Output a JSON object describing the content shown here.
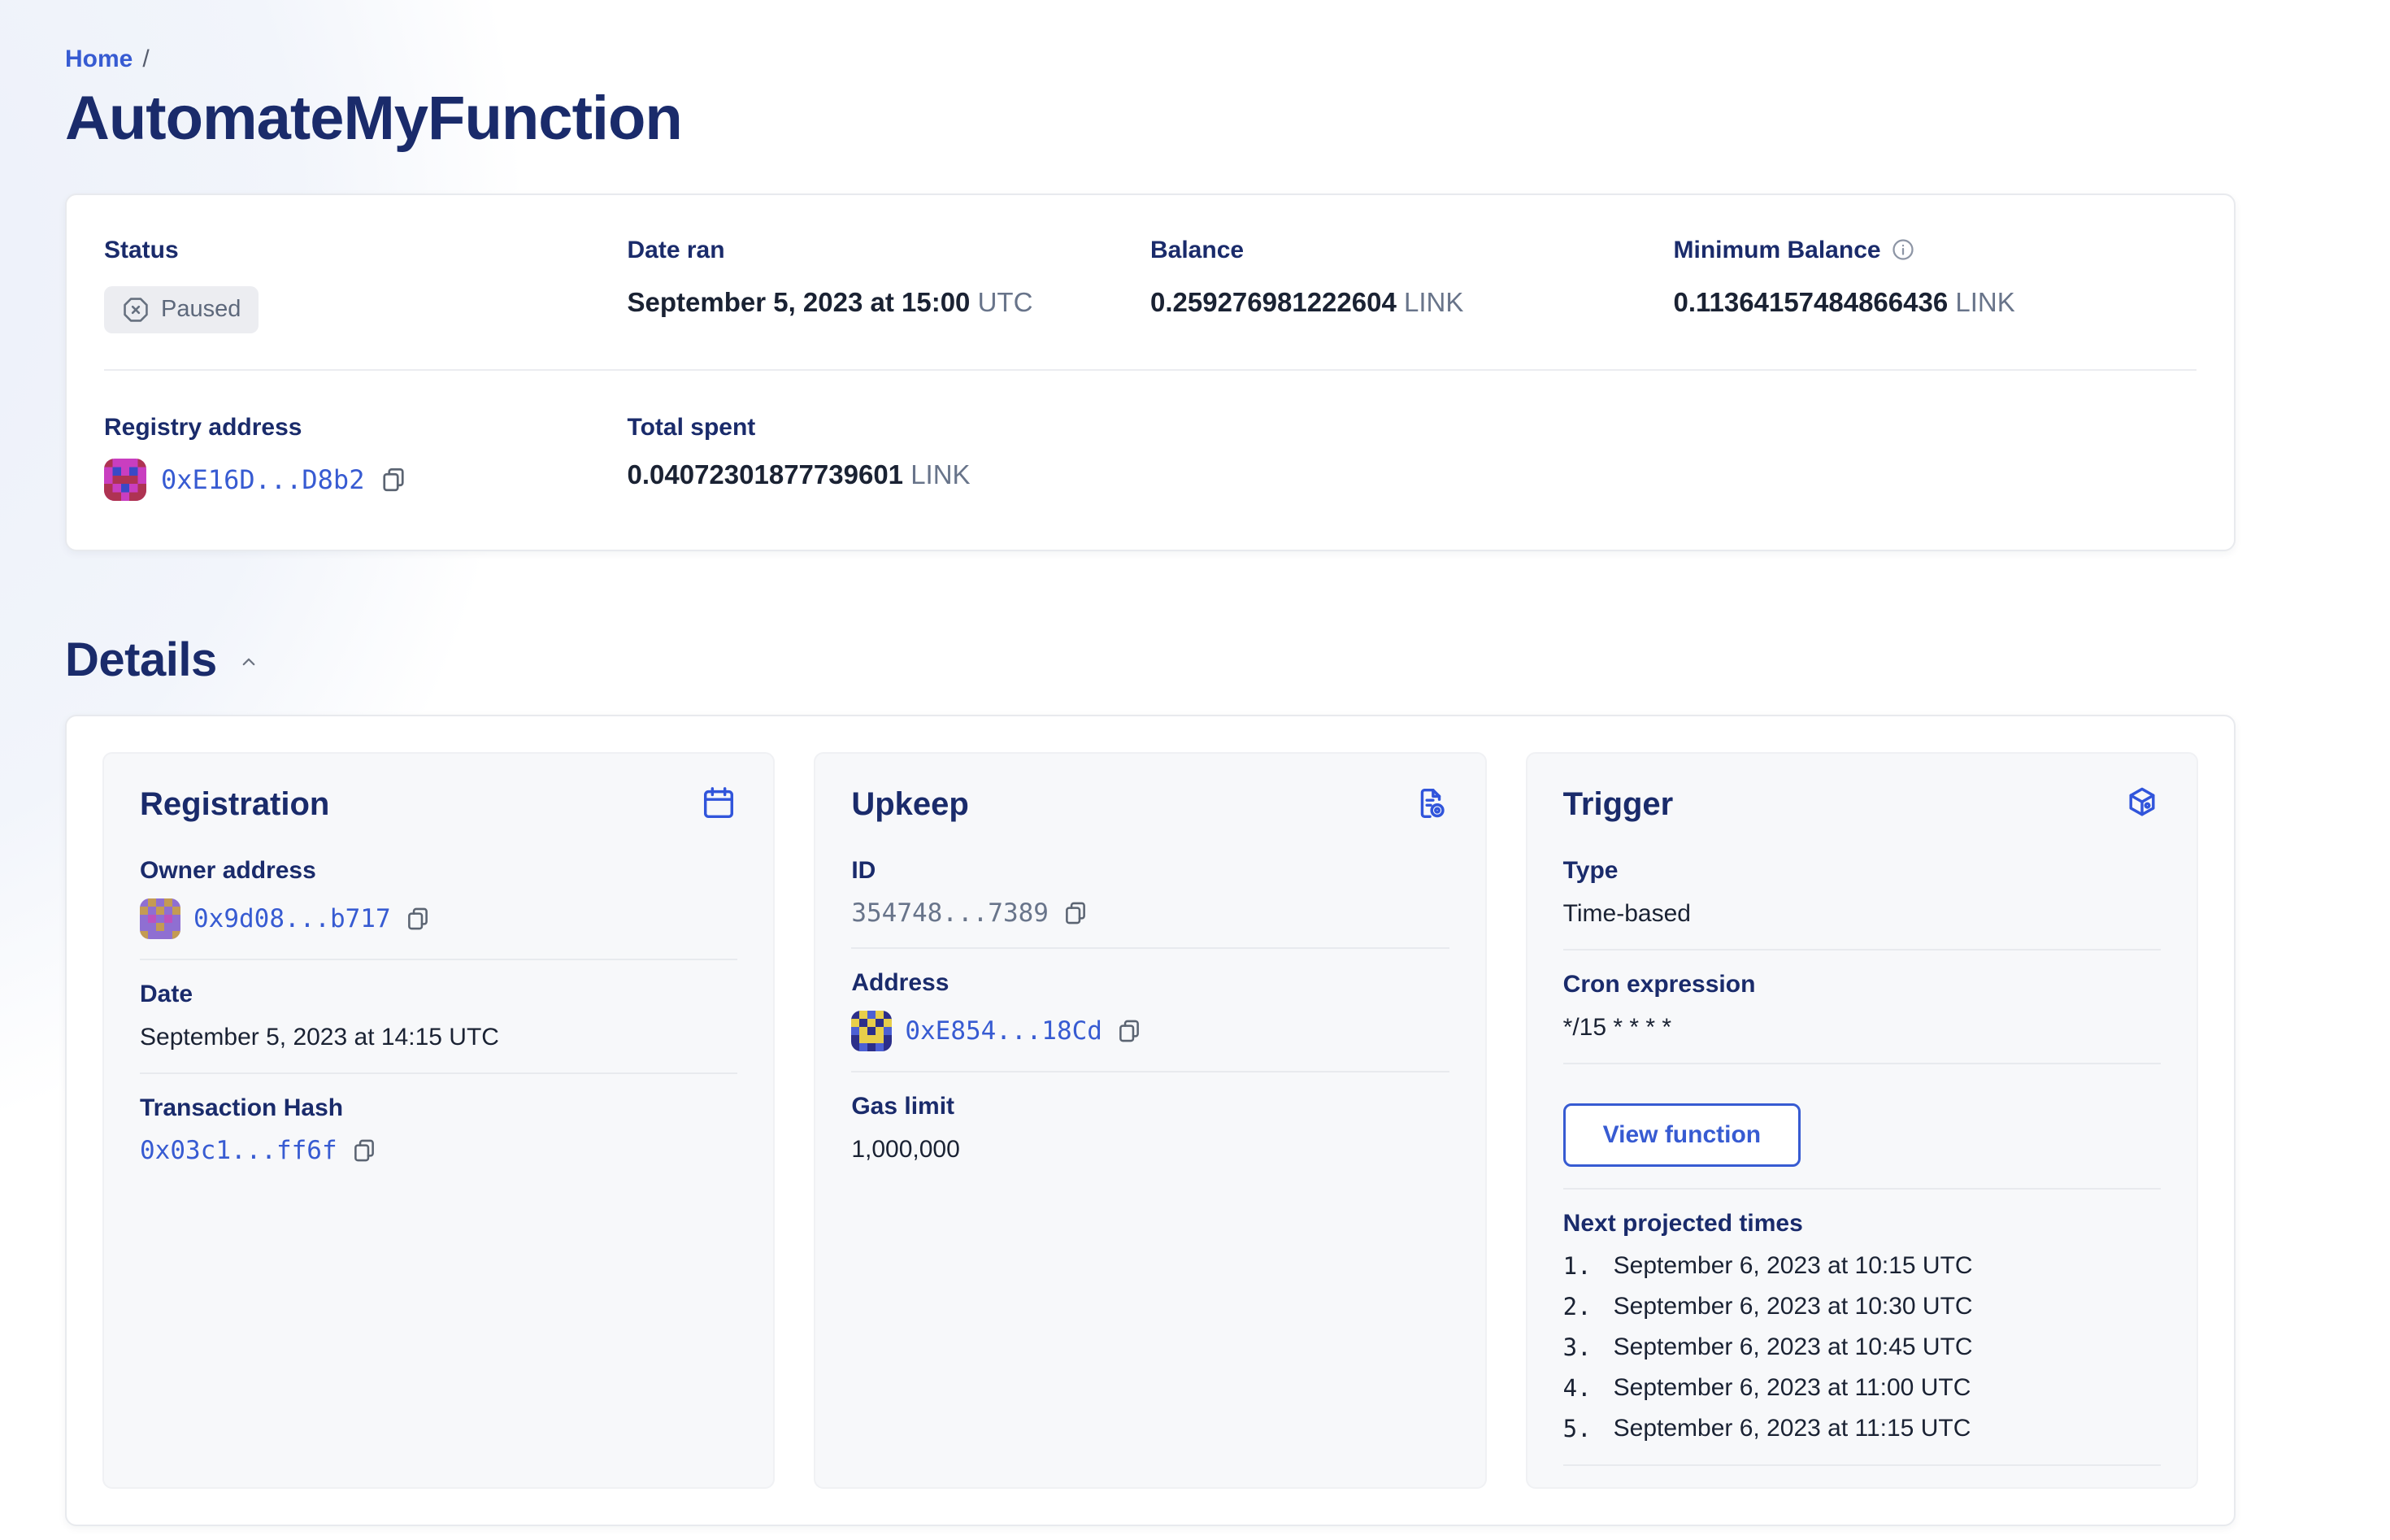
{
  "colors": {
    "link_blue": "#375BD2",
    "heading_navy": "#1A2B6B",
    "text_dark": "#1A2233",
    "text_gray": "#68748A",
    "badge_bg": "#ECEDF1",
    "card_border": "#E8EAEE",
    "inner_card_bg": "#F7F8FA",
    "icon_blue": "#3155DB"
  },
  "icons": {
    "status": "octagon-x-icon",
    "min_balance": "info-circle-icon",
    "copy": "copy-icon",
    "registration": "calendar-icon",
    "upkeep": "document-gear-icon",
    "trigger": "cube-icon",
    "details_toggle": "chevron-up-icon"
  },
  "identicons": {
    "registry": [
      "#C93EC0",
      "#AE3352",
      "#3A49C6"
    ],
    "owner": [
      "#8F6FD2",
      "#C49B53",
      "#BC52BE"
    ],
    "upkeep_address": [
      "#2C2F8A",
      "#E7CE4A",
      "#4C60D4"
    ]
  },
  "breadcrumb": {
    "home": "Home",
    "separator": "/"
  },
  "page_title": "AutomateMyFunction",
  "overview": {
    "status": {
      "label": "Status",
      "value": "Paused"
    },
    "date_ran": {
      "label": "Date ran",
      "value": "September 5, 2023 at 15:00",
      "suffix": "UTC"
    },
    "balance": {
      "label": "Balance",
      "value": "0.259276981222604",
      "suffix": "LINK"
    },
    "min_balance": {
      "label": "Minimum Balance",
      "value": "0.11364157484866436",
      "suffix": "LINK"
    },
    "registry": {
      "label": "Registry address",
      "address": "0xE16D...D8b2"
    },
    "total_spent": {
      "label": "Total spent",
      "value": "0.04072301877739601",
      "suffix": "LINK"
    }
  },
  "details": {
    "heading": "Details",
    "registration": {
      "title": "Registration",
      "owner": {
        "label": "Owner address",
        "address": "0x9d08...b717"
      },
      "date": {
        "label": "Date",
        "value": "September 5, 2023 at 14:15 UTC"
      },
      "tx": {
        "label": "Transaction Hash",
        "value": "0x03c1...ff6f"
      }
    },
    "upkeep": {
      "title": "Upkeep",
      "id": {
        "label": "ID",
        "value": "354748...7389"
      },
      "address": {
        "label": "Address",
        "value": "0xE854...18Cd"
      },
      "gas": {
        "label": "Gas limit",
        "value": "1,000,000"
      }
    },
    "trigger": {
      "title": "Trigger",
      "type": {
        "label": "Type",
        "value": "Time-based"
      },
      "cron": {
        "label": "Cron expression",
        "value": "*/15 * * * *"
      },
      "view_function_label": "View function",
      "next_times": {
        "label": "Next projected times",
        "items": [
          {
            "num": "1.",
            "text": "September 6, 2023 at 10:15 UTC"
          },
          {
            "num": "2.",
            "text": "September 6, 2023 at 10:30 UTC"
          },
          {
            "num": "3.",
            "text": "September 6, 2023 at 10:45 UTC"
          },
          {
            "num": "4.",
            "text": "September 6, 2023 at 11:00 UTC"
          },
          {
            "num": "5.",
            "text": "September 6, 2023 at 11:15 UTC"
          }
        ]
      }
    }
  }
}
